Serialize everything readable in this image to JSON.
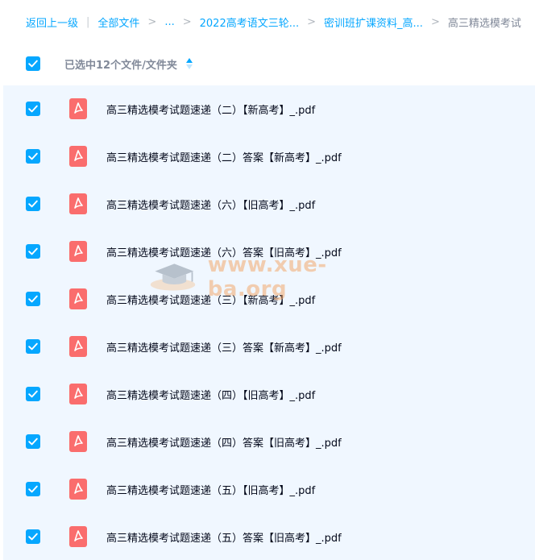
{
  "breadcrumb": {
    "back_label": "返回上一级",
    "pipe": "|",
    "items": [
      "全部文件",
      "...",
      "2022高考语文三轮...",
      "密训班扩课资料_高...",
      "高三精选模考试"
    ],
    "separator": ">"
  },
  "selection": {
    "summary": "已选中12个文件/文件夹",
    "all_checked": true
  },
  "files": [
    {
      "name": "高三精选模考试题速递（二）【新高考】_.pdf",
      "checked": true
    },
    {
      "name": "高三精选模考试题速递（二）答案【新高考】_.pdf",
      "checked": true
    },
    {
      "name": "高三精选模考试题速递（六）【旧高考】_.pdf",
      "checked": true
    },
    {
      "name": "高三精选模考试题速递（六）答案【旧高考】_.pdf",
      "checked": true
    },
    {
      "name": "高三精选模考试题速递（三）【新高考】_.pdf",
      "checked": true
    },
    {
      "name": "高三精选模考试题速递（三）答案【新高考】_.pdf",
      "checked": true
    },
    {
      "name": "高三精选模考试题速递（四）【旧高考】_.pdf",
      "checked": true
    },
    {
      "name": "高三精选模考试题速递（四）答案【旧高考】_.pdf",
      "checked": true
    },
    {
      "name": "高三精选模考试题速递（五）【旧高考】_.pdf",
      "checked": true
    },
    {
      "name": "高三精选模考试题速递（五）答案【旧高考】_.pdf",
      "checked": true
    }
  ],
  "watermark": {
    "text": "www.xue-ba.org"
  },
  "colors": {
    "accent": "#06a7ff",
    "pdf_icon": "#fa6d6d",
    "row_bg": "#f0f7ff",
    "muted_text": "#818999"
  },
  "icons": {
    "checkbox": "check-icon",
    "file_type": "pdf-icon",
    "sort": "sort-icon"
  }
}
